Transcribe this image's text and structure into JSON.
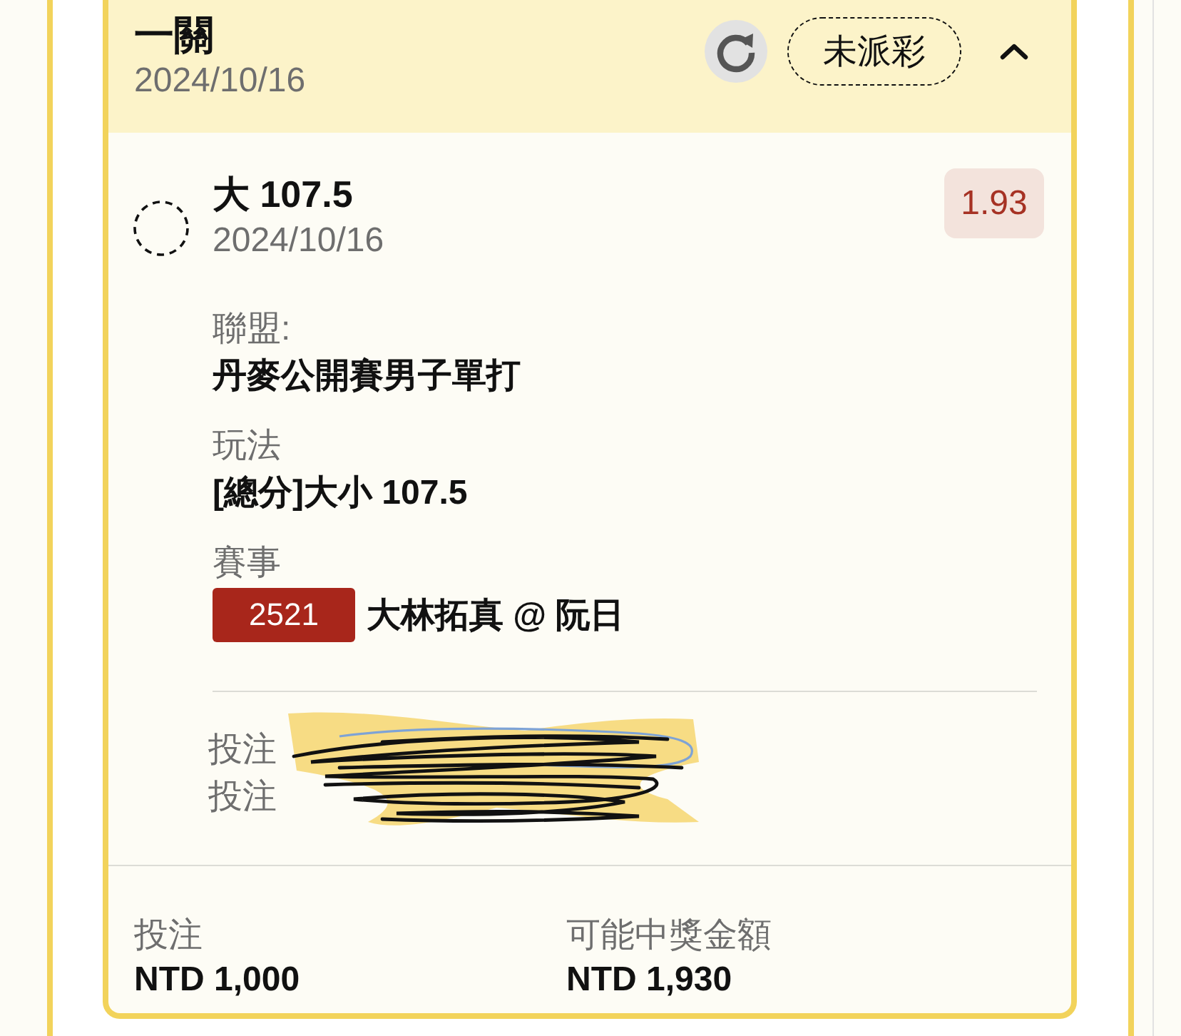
{
  "bet_slip": {
    "title": "一關",
    "date": "2024/10/16",
    "status": "未派彩",
    "expanded": true
  },
  "selection": {
    "pick": "大 107.5",
    "date": "2024/10/16",
    "odds": "1.93",
    "details": [
      {
        "kind": "text",
        "label": "聯盟:",
        "value": "丹麥公開賽男子單打"
      },
      {
        "kind": "text",
        "label": "玩法",
        "value": "[總分]大小 107.5"
      },
      {
        "kind": "match",
        "label": "賽事",
        "match_id": "2521",
        "value": "大林拓真 @ 阮日"
      }
    ]
  },
  "bet_info_lines": [
    "投注",
    "投注"
  ],
  "summary": [
    {
      "label": "投注",
      "value": "NTD 1,000"
    },
    {
      "label": "可能中獎金額",
      "value": "NTD 1,930"
    }
  ]
}
